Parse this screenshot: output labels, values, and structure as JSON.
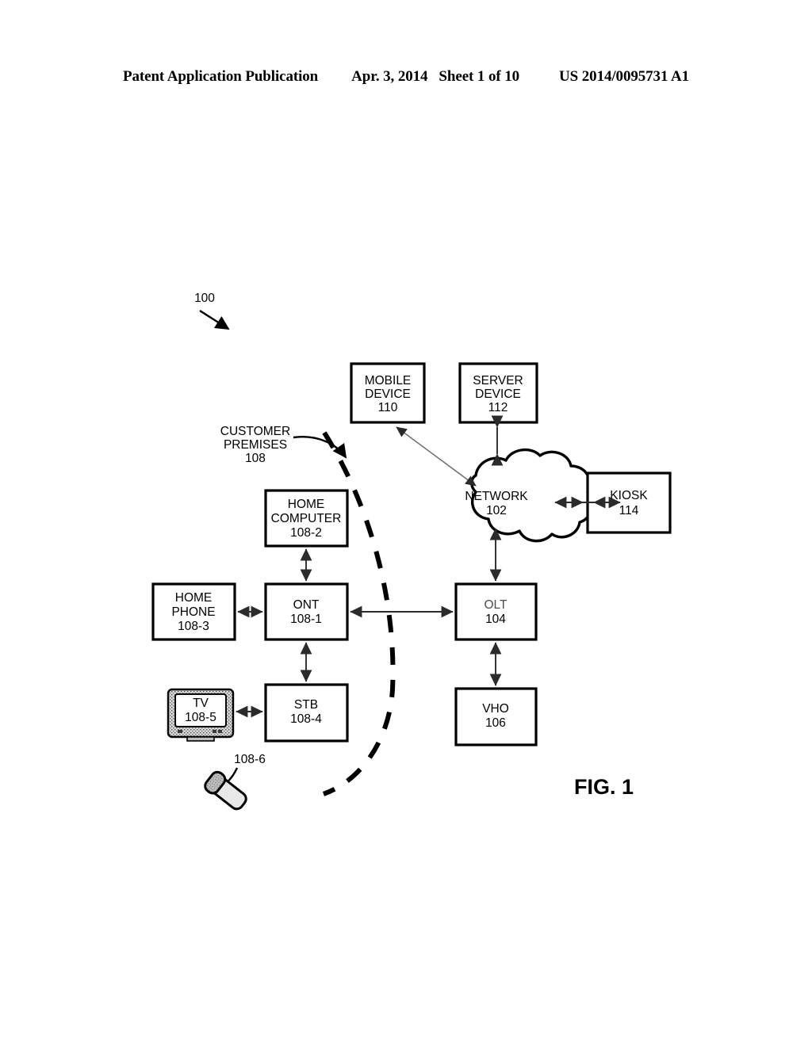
{
  "header": {
    "publication": "Patent Application Publication",
    "date": "Apr. 3, 2014",
    "sheet": "Sheet 1 of 10",
    "patent_number": "US 2014/0095731 A1"
  },
  "figure": {
    "caption": "FIG. 1",
    "system_ref": "100",
    "boundary_label": {
      "line1": "CUSTOMER",
      "line2": "PREMISES",
      "ref": "108"
    },
    "nodes": [
      {
        "id": "mobile-device",
        "line1": "MOBILE",
        "line2": "DEVICE",
        "ref": "110"
      },
      {
        "id": "server-device",
        "line1": "SERVER",
        "line2": "DEVICE",
        "ref": "112"
      },
      {
        "id": "network",
        "line1": "NETWORK",
        "ref": "102"
      },
      {
        "id": "kiosk",
        "line1": "KIOSK",
        "ref": "114"
      },
      {
        "id": "home-computer",
        "line1": "HOME",
        "line2": "COMPUTER",
        "ref": "108-2"
      },
      {
        "id": "home-phone",
        "line1": "HOME",
        "line2": "PHONE",
        "ref": "108-3"
      },
      {
        "id": "ont",
        "line1": "ONT",
        "ref": "108-1"
      },
      {
        "id": "olt",
        "line1": "OLT",
        "ref": "104"
      },
      {
        "id": "tv",
        "line1": "TV",
        "ref": "108-5"
      },
      {
        "id": "stb",
        "line1": "STB",
        "ref": "108-4"
      },
      {
        "id": "vho",
        "line1": "VHO",
        "ref": "106"
      },
      {
        "id": "remote-control",
        "ref": "108-6"
      }
    ],
    "colors": {
      "ink": "#000000",
      "connector": "#2b2b2b",
      "thin_connector": "#6e6e6e",
      "paper": "#ffffff"
    }
  }
}
